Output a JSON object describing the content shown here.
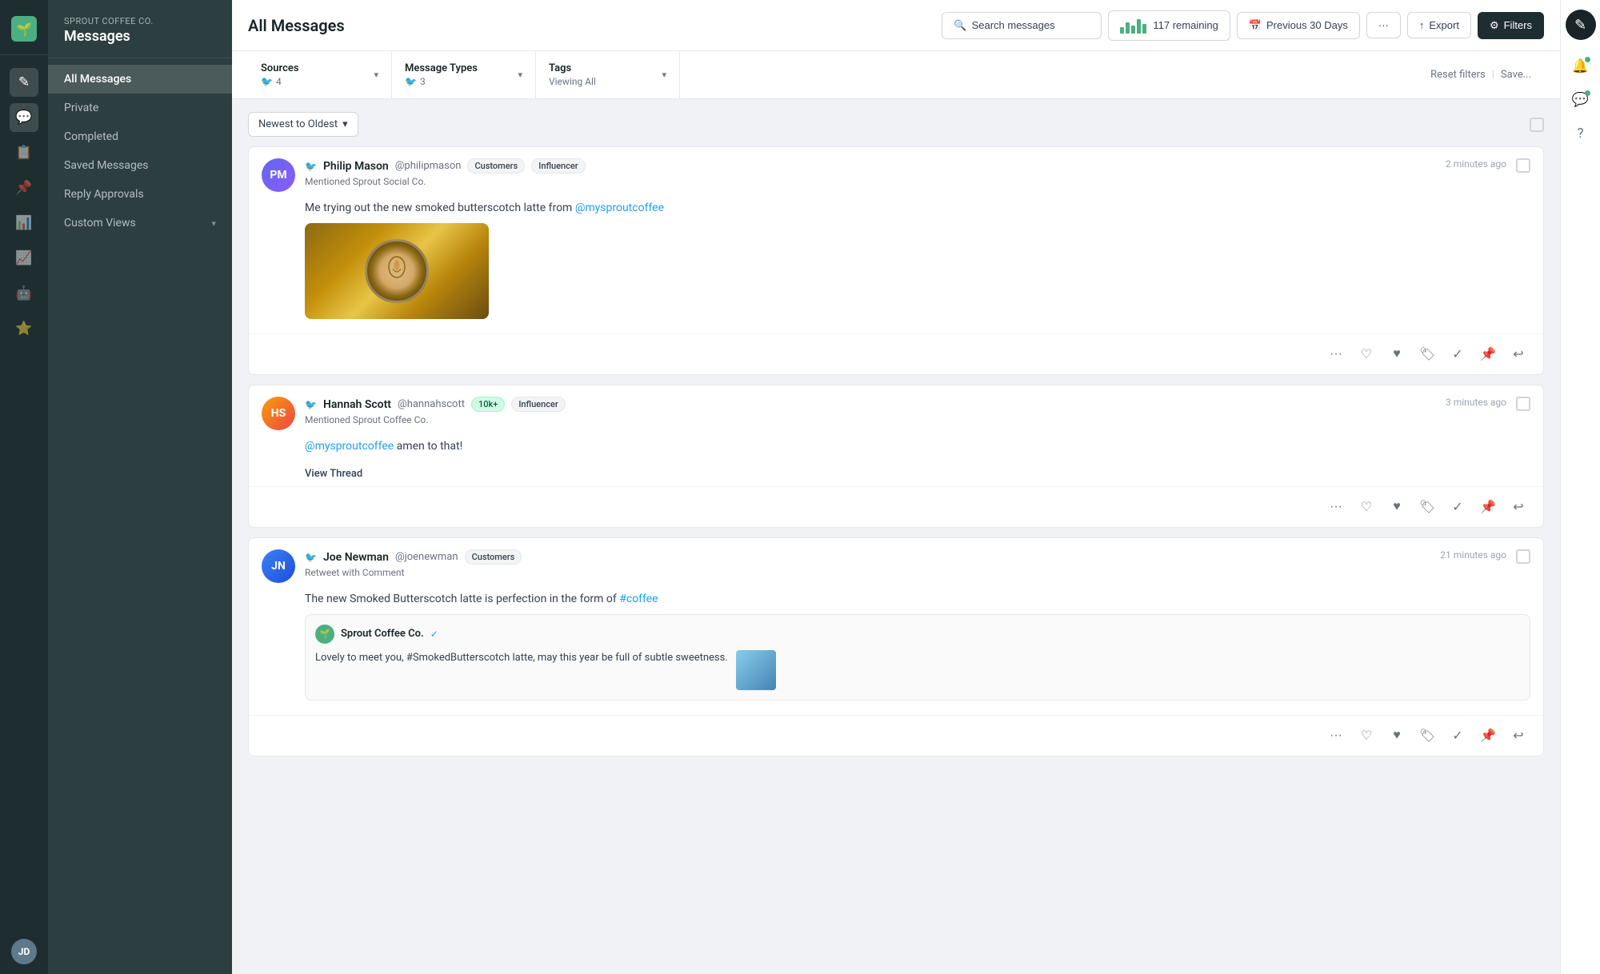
{
  "app": {
    "brand": "Sprout Coffee Co.",
    "section": "Messages"
  },
  "sidebar": {
    "icons": [
      {
        "name": "compose",
        "symbol": "✎",
        "active": false
      },
      {
        "name": "messages",
        "symbol": "💬",
        "active": true
      },
      {
        "name": "tasks",
        "symbol": "📋",
        "active": false
      },
      {
        "name": "pin",
        "symbol": "📌",
        "active": false
      },
      {
        "name": "analytics",
        "symbol": "📊",
        "active": false
      },
      {
        "name": "reports",
        "symbol": "📈",
        "active": false
      },
      {
        "name": "automation",
        "symbol": "🤖",
        "active": false
      },
      {
        "name": "star",
        "symbol": "⭐",
        "active": false
      }
    ]
  },
  "nav": {
    "items": [
      {
        "label": "All Messages",
        "active": true
      },
      {
        "label": "Private",
        "active": false
      },
      {
        "label": "Completed",
        "active": false
      },
      {
        "label": "Saved Messages",
        "active": false
      },
      {
        "label": "Reply Approvals",
        "active": false
      },
      {
        "label": "Custom Views",
        "active": false,
        "hasChevron": true
      }
    ]
  },
  "header": {
    "title": "All Messages",
    "search_placeholder": "Search messages",
    "remaining": "117 remaining",
    "date_range": "Previous 30 Days",
    "more_label": "···",
    "export_label": "Export",
    "filters_label": "Filters"
  },
  "filters": {
    "sources": {
      "label": "Sources",
      "sub_icon": "🐦",
      "sub_count": "4"
    },
    "message_types": {
      "label": "Message Types",
      "sub_icon": "🐦",
      "sub_count": "3"
    },
    "tags": {
      "label": "Tags",
      "sub_label": "Viewing All"
    },
    "reset_label": "Reset filters",
    "save_label": "Save..."
  },
  "sort": {
    "label": "Newest to Oldest"
  },
  "messages": [
    {
      "id": 1,
      "author": "Philip Mason",
      "handle": "@philipmason",
      "avatar_initials": "PM",
      "avatar_class": "philip",
      "sub": "Mentioned Sprout Social Co.",
      "time": "2 minutes ago",
      "tags": [
        "Customers",
        "Influencer"
      ],
      "body_prefix": "Me trying out the new smoked butterscotch latte from ",
      "body_link": "@mysproutcoffee",
      "body_suffix": "",
      "has_image": true,
      "has_thread": false
    },
    {
      "id": 2,
      "author": "Hannah Scott",
      "handle": "@hannahscott",
      "avatar_initials": "HS",
      "avatar_class": "hannah",
      "sub": "Mentioned Sprout Coffee Co.",
      "time": "3 minutes ago",
      "tags": [
        "10k+",
        "Influencer"
      ],
      "tags_special": [
        {
          "label": "10k+",
          "green": true
        },
        {
          "label": "Influencer",
          "green": false
        }
      ],
      "body_link_prefix": "@mysproutcoffee",
      "body_suffix": " amen to that!",
      "has_image": false,
      "has_thread": true,
      "thread_label": "View Thread"
    },
    {
      "id": 3,
      "author": "Joe Newman",
      "handle": "@joenewman",
      "avatar_initials": "JN",
      "avatar_class": "joe",
      "sub": "Retweet with Comment",
      "time": "21 minutes ago",
      "tags": [
        "Customers"
      ],
      "body_prefix": "The new Smoked Butterscotch latte is perfection in the form of ",
      "body_hash": "#coffee",
      "has_image": false,
      "has_embed": true,
      "embed": {
        "author": "Sprout Coffee Co.",
        "verified": true,
        "body": "Lovely to meet you, #SmokedButterscotch latte, may this year be full of subtle sweetness."
      }
    }
  ],
  "actions": {
    "more": "···",
    "like_outline": "♡",
    "like_filled": "♥",
    "tag": "🏷",
    "check": "✓",
    "pin": "📌",
    "reply": "↩"
  },
  "right_sidebar": {
    "compose_icon": "+",
    "notif_icon": "🔔",
    "comment_icon": "💬",
    "help_icon": "?"
  }
}
